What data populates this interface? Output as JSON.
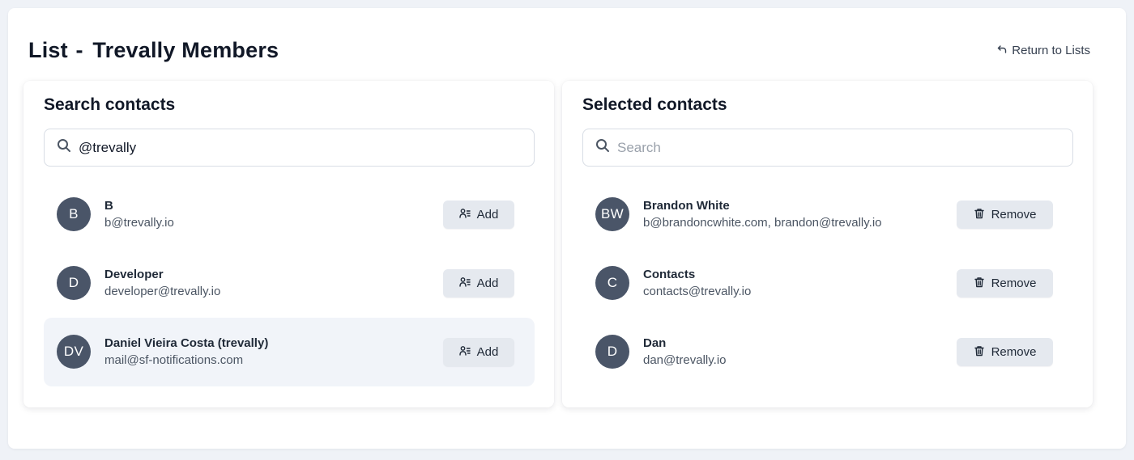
{
  "header": {
    "title_prefix": "List",
    "title_separator": "-",
    "title_name": "Trevally Members",
    "return_label": "Return to Lists"
  },
  "search_panel": {
    "title": "Search contacts",
    "search_value": "@trevally",
    "add_label": "Add",
    "contacts": [
      {
        "initials": "B",
        "name": "B",
        "email": "b@trevally.io",
        "highlighted": false
      },
      {
        "initials": "D",
        "name": "Developer",
        "email": "developer@trevally.io",
        "highlighted": false
      },
      {
        "initials": "DV",
        "name": "Daniel Vieira Costa (trevally)",
        "email": "mail@sf-notifications.com",
        "highlighted": true
      }
    ]
  },
  "selected_panel": {
    "title": "Selected contacts",
    "search_placeholder": "Search",
    "remove_label": "Remove",
    "contacts": [
      {
        "initials": "BW",
        "name": "Brandon White",
        "email": "b@brandoncwhite.com, brandon@trevally.io"
      },
      {
        "initials": "C",
        "name": "Contacts",
        "email": "contacts@trevally.io"
      },
      {
        "initials": "D",
        "name": "Dan",
        "email": "dan@trevally.io"
      }
    ]
  },
  "icons": {
    "search": "search-icon",
    "return": "return-arrow-icon",
    "add": "user-add-icon",
    "remove": "trash-icon"
  },
  "colors": {
    "avatar_bg": "#4a5568",
    "button_bg": "#e5e9ef",
    "highlight_row": "#f1f4f9",
    "page_bg": "#eff2f7"
  }
}
